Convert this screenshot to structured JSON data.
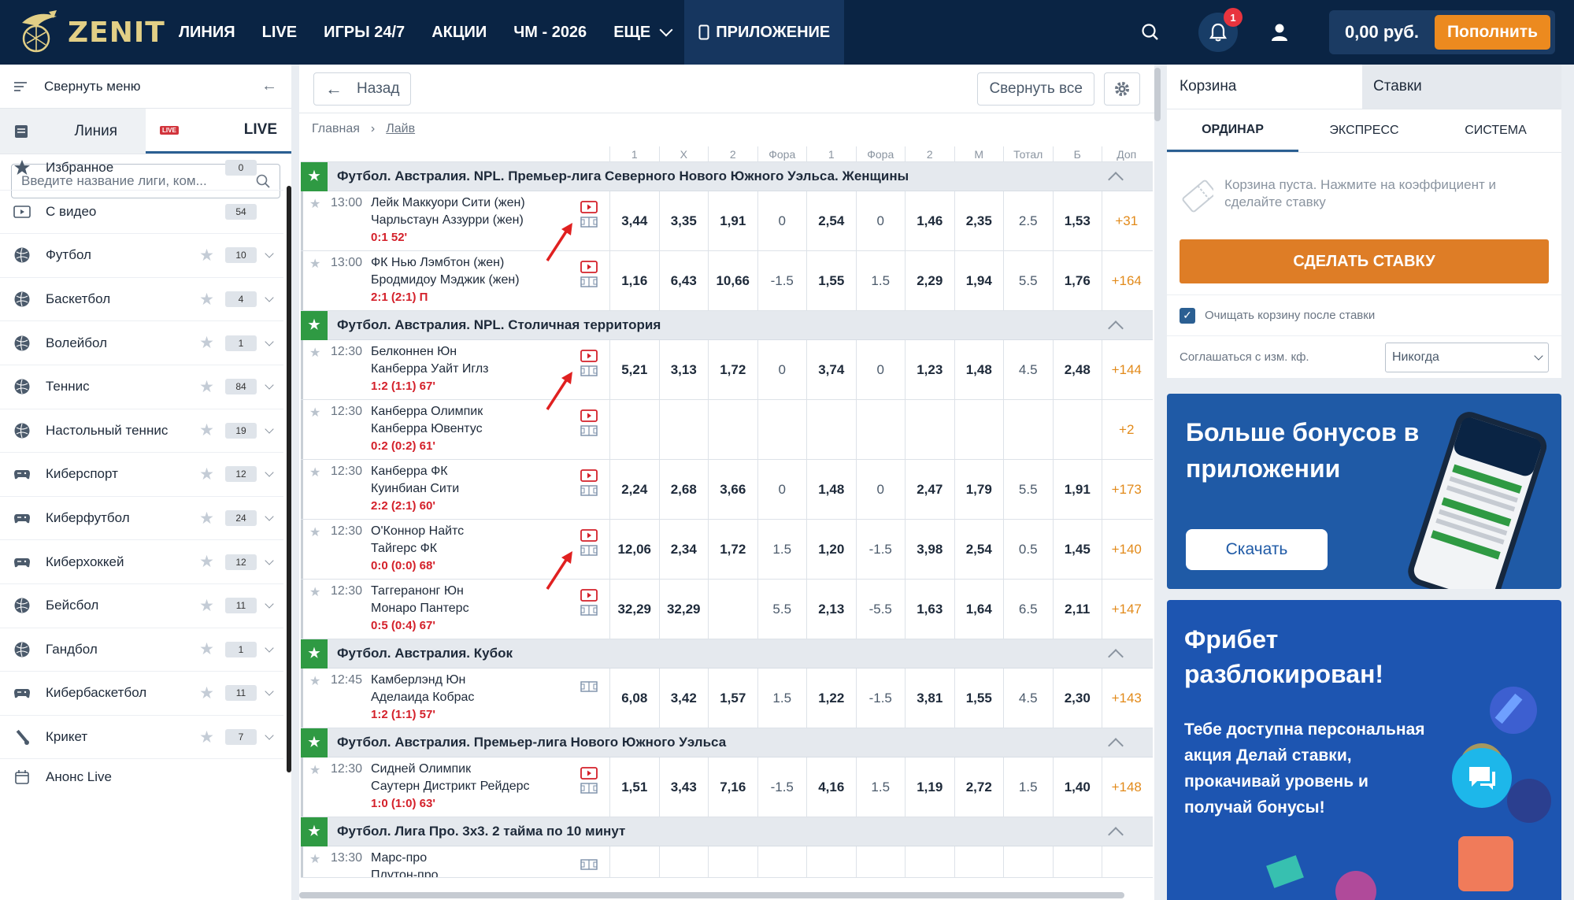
{
  "header": {
    "logo": "ZENIT",
    "nav": [
      "ЛИНИЯ",
      "LIVE",
      "ИГРЫ 24/7",
      "АКЦИИ",
      "ЧМ - 2026",
      "ЕЩЕ",
      "ПРИЛОЖЕНИЕ"
    ],
    "notifications": "1",
    "balance": "0,00 руб.",
    "deposit": "Пополнить"
  },
  "sidebar": {
    "collapse": "Свернуть меню",
    "tab_linia": "Линия",
    "tab_live": "LIVE",
    "live_mini": "LIVE",
    "search_placeholder": "Введите название лиги, ком...",
    "items": [
      {
        "name": "Избранное",
        "count": "0",
        "icon": "star-icon"
      },
      {
        "name": "С видео",
        "count": "54",
        "icon": "video-icon"
      },
      {
        "name": "Футбол",
        "count": "10",
        "icon": "football-icon"
      },
      {
        "name": "Баскетбол",
        "count": "4",
        "icon": "basketball-icon"
      },
      {
        "name": "Волейбол",
        "count": "1",
        "icon": "volleyball-icon"
      },
      {
        "name": "Теннис",
        "count": "84",
        "icon": "tennis-icon"
      },
      {
        "name": "Настольный теннис",
        "count": "19",
        "icon": "table-tennis-icon"
      },
      {
        "name": "Киберспорт",
        "count": "12",
        "icon": "gamepad-icon"
      },
      {
        "name": "Киберфутбол",
        "count": "24",
        "icon": "gamepad-icon"
      },
      {
        "name": "Киберхоккей",
        "count": "12",
        "icon": "gamepad-icon"
      },
      {
        "name": "Бейсбол",
        "count": "11",
        "icon": "baseball-icon"
      },
      {
        "name": "Гандбол",
        "count": "1",
        "icon": "handball-icon"
      },
      {
        "name": "Кибербаскетбол",
        "count": "11",
        "icon": "gamepad-icon"
      },
      {
        "name": "Крикет",
        "count": "7",
        "icon": "cricket-icon"
      },
      {
        "name": "Анонс Live",
        "count": "",
        "icon": "calendar-icon"
      }
    ]
  },
  "main": {
    "back": "Назад",
    "collapse_all": "Свернуть все",
    "crumb_home": "Главная",
    "crumb_current": "Лайв",
    "columns": [
      "1",
      "X",
      "2",
      "Фора",
      "1",
      "Фора",
      "2",
      "М",
      "Тотал",
      "Б",
      "Доп"
    ],
    "leagues": [
      {
        "name": "Футбол. Австралия. NPL. Премьер-лига Северного Нового Южного Уэльса. Женщины",
        "matches": [
          {
            "time": "13:00",
            "t1": "Лейк Маккуори Сити (жен)",
            "t2": "Чарльстаун Аззурри (жен)",
            "score": "0:1 52'",
            "video": true,
            "arrow": true,
            "odds": [
              "3,44",
              "3,35",
              "1,91",
              "0",
              "2,54",
              "0",
              "1,46",
              "2,35",
              "2.5",
              "1,53",
              "+31"
            ]
          },
          {
            "time": "13:00",
            "t1": "ФК Нью Лэмбтон (жен)",
            "t2": "Бродмидоу Мэджик (жен)",
            "score": "2:1 (2:1) П",
            "video": true,
            "arrow": false,
            "odds": [
              "1,16",
              "6,43",
              "10,66",
              "-1.5",
              "1,55",
              "1.5",
              "2,29",
              "1,94",
              "5.5",
              "1,76",
              "+164"
            ]
          }
        ]
      },
      {
        "name": "Футбол. Австралия. NPL. Столичная территория",
        "matches": [
          {
            "time": "12:30",
            "t1": "Белконнен Юн",
            "t2": "Канберра Уайт Иглз",
            "score": "1:2 (1:1) 67'",
            "video": true,
            "arrow": true,
            "odds": [
              "5,21",
              "3,13",
              "1,72",
              "0",
              "3,74",
              "0",
              "1,23",
              "1,48",
              "4.5",
              "2,48",
              "+144"
            ]
          },
          {
            "time": "12:30",
            "t1": "Канберра Олимпик",
            "t2": "Канберра Ювентус",
            "score": "0:2 (0:2) 61'",
            "video": true,
            "arrow": false,
            "odds": [
              "",
              "",
              "",
              "",
              "",
              "",
              "",
              "",
              "",
              "",
              "+2"
            ]
          },
          {
            "time": "12:30",
            "t1": "Канберра ФК",
            "t2": "Куинбиан Сити",
            "score": "2:2 (2:1) 60'",
            "video": true,
            "arrow": false,
            "odds": [
              "2,24",
              "2,68",
              "3,66",
              "0",
              "1,48",
              "0",
              "2,47",
              "1,79",
              "5.5",
              "1,91",
              "+173"
            ]
          },
          {
            "time": "12:30",
            "t1": "О'Коннор Найтс",
            "t2": "Тайгерс ФК",
            "score": "0:0 (0:0) 68'",
            "video": true,
            "arrow": true,
            "odds": [
              "12,06",
              "2,34",
              "1,72",
              "1.5",
              "1,20",
              "-1.5",
              "3,98",
              "2,54",
              "0.5",
              "1,45",
              "+140"
            ]
          },
          {
            "time": "12:30",
            "t1": "Таггеранонг Юн",
            "t2": "Монаро Пантерс",
            "score": "0:5 (0:4) 67'",
            "video": true,
            "arrow": false,
            "odds": [
              "32,29",
              "32,29",
              "",
              "5.5",
              "2,13",
              "-5.5",
              "1,63",
              "1,64",
              "6.5",
              "2,11",
              "+147"
            ]
          }
        ]
      },
      {
        "name": "Футбол. Австралия. Кубок",
        "matches": [
          {
            "time": "12:45",
            "t1": "Камберлэнд Юн",
            "t2": "Аделаида Кобрас",
            "score": "1:2 (1:1) 57'",
            "video": false,
            "arrow": false,
            "odds": [
              "6,08",
              "3,42",
              "1,57",
              "1.5",
              "1,22",
              "-1.5",
              "3,81",
              "1,55",
              "4.5",
              "2,30",
              "+143"
            ]
          }
        ]
      },
      {
        "name": "Футбол. Австралия. Премьер-лига Нового Южного Уэльса",
        "matches": [
          {
            "time": "12:30",
            "t1": "Сидней Олимпик",
            "t2": "Саутерн Дистрикт Рейдерс",
            "score": "1:0 (1:0) 63'",
            "video": true,
            "arrow": false,
            "odds": [
              "1,51",
              "3,43",
              "7,16",
              "-1.5",
              "4,16",
              "1.5",
              "1,19",
              "2,72",
              "1.5",
              "1,40",
              "+148"
            ]
          }
        ]
      },
      {
        "name": "Футбол. Лига Про. 3х3. 2 тайма по 10 минут",
        "matches": [
          {
            "time": "13:30",
            "t1": "Марс-про",
            "t2": "Плутон-про",
            "score": "",
            "video": false,
            "arrow": false,
            "odds": [
              "",
              "",
              "",
              "",
              "",
              "",
              "",
              "",
              "",
              "",
              ""
            ]
          }
        ]
      }
    ]
  },
  "right": {
    "tab_cart": "Корзина",
    "tab_bets": "Ставки",
    "sub": [
      "ОРДИНАР",
      "ЭКСПРЕСС",
      "СИСТЕМА"
    ],
    "empty": "Корзина пуста. Нажмите на коэффициент и сделайте ставку",
    "make_bet": "СДЕЛАТЬ СТАВКУ",
    "clear_after": "Очищать корзину после ставки",
    "agree_label": "Соглашаться с изм. кф.",
    "agree_value": "Никогда",
    "promo1_title": "Больше бонусов в приложении",
    "promo1_btn": "Скачать",
    "promo2_title1": "Фрибет",
    "promo2_title2": "разблокирован!",
    "promo2_text": "Тебе доступна персональная акция Делай ставки, прокачивай уровень и получай бонусы!"
  },
  "colors": {
    "header": "#0a2444",
    "accent": "#ec8a1f",
    "live_green": "#2f9a43",
    "score_red": "#d4202a",
    "more_orange": "#e28a1a"
  }
}
